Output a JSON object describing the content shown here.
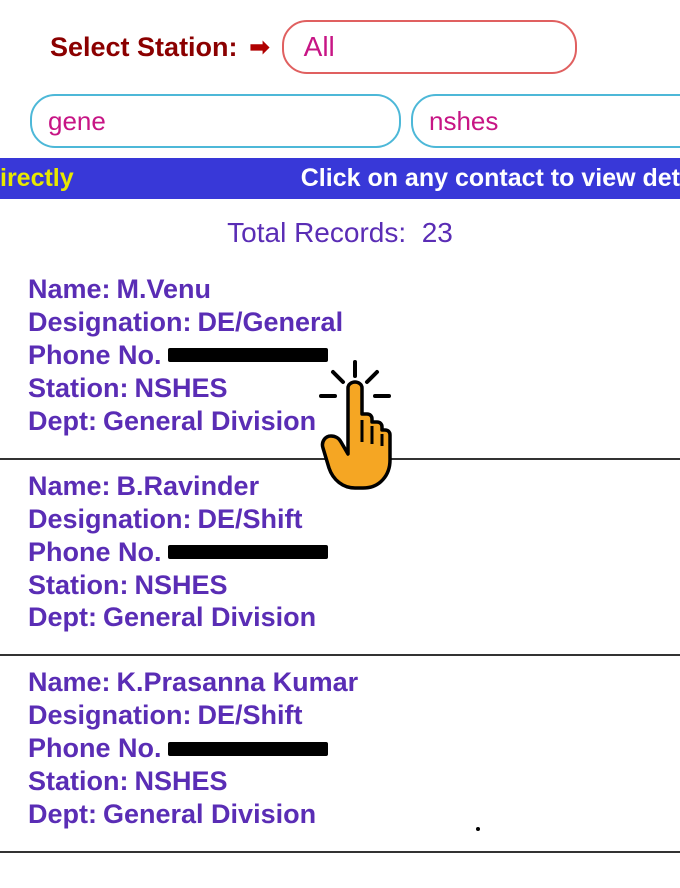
{
  "header": {
    "station_label": "Select Station:",
    "station_value": "All",
    "search1_value": "gene",
    "search2_value": "nshes"
  },
  "banner": {
    "left": "irectly",
    "right": "Click on any contact to view det"
  },
  "total": {
    "label": "Total Records:",
    "count": "23"
  },
  "labels": {
    "name": "Name:",
    "designation": "Designation:",
    "phone": "Phone No.",
    "station": "Station:",
    "dept": "Dept:"
  },
  "contacts": [
    {
      "name": "M.Venu",
      "designation": "DE/General",
      "station": "NSHES",
      "dept": "General Division"
    },
    {
      "name": "B.Ravinder",
      "designation": "DE/Shift",
      "station": "NSHES",
      "dept": "General Division"
    },
    {
      "name": "K.Prasanna Kumar",
      "designation": "DE/Shift",
      "station": "NSHES",
      "dept": "General Division"
    }
  ]
}
